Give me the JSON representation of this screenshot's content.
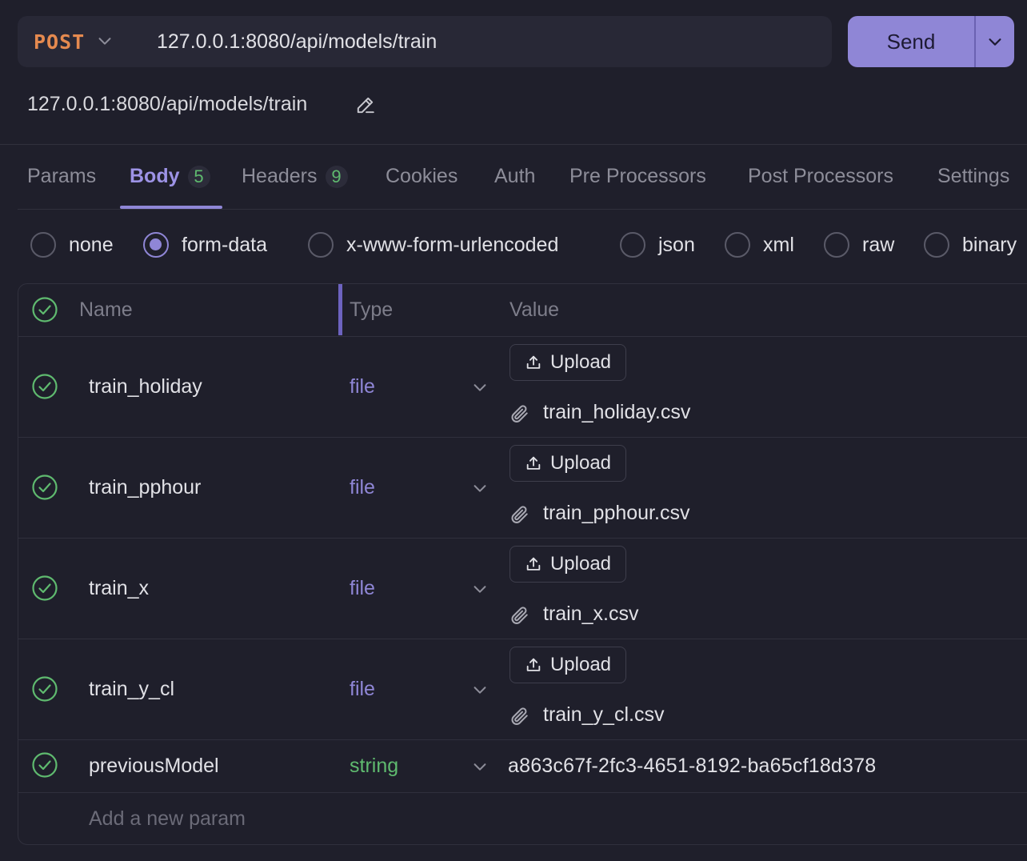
{
  "request": {
    "method": "POST",
    "url": "127.0.0.1:8080/api/models/train",
    "name": "127.0.0.1:8080/api/models/train",
    "send_label": "Send"
  },
  "tabs": [
    {
      "label": "Params",
      "badge": "",
      "active": false
    },
    {
      "label": "Body",
      "badge": "5",
      "active": true
    },
    {
      "label": "Headers",
      "badge": "9",
      "active": false
    },
    {
      "label": "Cookies",
      "badge": "",
      "active": false
    },
    {
      "label": "Auth",
      "badge": "",
      "active": false
    },
    {
      "label": "Pre Processors",
      "badge": "",
      "active": false
    },
    {
      "label": "Post Processors",
      "badge": "",
      "active": false
    },
    {
      "label": "Settings",
      "badge": "",
      "active": false
    }
  ],
  "body_types": [
    {
      "label": "none",
      "selected": false
    },
    {
      "label": "form-data",
      "selected": true
    },
    {
      "label": "x-www-form-urlencoded",
      "selected": false
    },
    {
      "label": "json",
      "selected": false
    },
    {
      "label": "xml",
      "selected": false
    },
    {
      "label": "raw",
      "selected": false
    },
    {
      "label": "binary",
      "selected": false
    }
  ],
  "table": {
    "headers": {
      "name": "Name",
      "type": "Type",
      "value": "Value"
    },
    "upload_label": "Upload",
    "rows": [
      {
        "name": "train_holiday",
        "type": "file",
        "file": "train_holiday.csv",
        "enabled": true
      },
      {
        "name": "train_pphour",
        "type": "file",
        "file": "train_pphour.csv",
        "enabled": true
      },
      {
        "name": "train_x",
        "type": "file",
        "file": "train_x.csv",
        "enabled": true
      },
      {
        "name": "train_y_cl",
        "type": "file",
        "file": "train_y_cl.csv",
        "enabled": true
      },
      {
        "name": "previousModel",
        "type": "string",
        "value": "a863c67f-2fc3-4651-8192-ba65cf18d378",
        "enabled": true
      }
    ],
    "add_placeholder": "Add a new param"
  },
  "colors": {
    "accent": "#8f86d6",
    "method": "#e58a4f",
    "check": "#5fba6f",
    "background": "#1f1f2b"
  },
  "icons": [
    "chevron-down-icon",
    "edit-pencil-icon",
    "check-circle-icon",
    "upload-icon",
    "paperclip-icon"
  ]
}
